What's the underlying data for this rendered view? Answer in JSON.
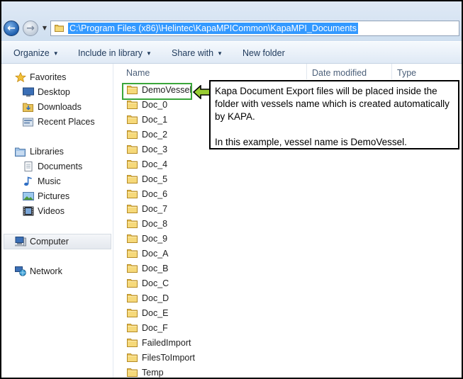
{
  "address_bar": {
    "path": "C:\\Program Files (x86)\\Helintec\\KapaMPICommon\\KapaMPI_Documents"
  },
  "toolbar": {
    "organize": "Organize",
    "include_in_library": "Include in library",
    "share_with": "Share with",
    "new_folder": "New folder"
  },
  "nav_pane": {
    "favorites": {
      "label": "Favorites",
      "items": [
        "Desktop",
        "Downloads",
        "Recent Places"
      ]
    },
    "libraries": {
      "label": "Libraries",
      "items": [
        "Documents",
        "Music",
        "Pictures",
        "Videos"
      ]
    },
    "computer": "Computer",
    "network": "Network"
  },
  "columns": {
    "name": "Name",
    "date_modified": "Date modified",
    "type": "Type"
  },
  "files": [
    "DemoVessel",
    "Doc_0",
    "Doc_1",
    "Doc_2",
    "Doc_3",
    "Doc_4",
    "Doc_5",
    "Doc_6",
    "Doc_7",
    "Doc_8",
    "Doc_9",
    "Doc_A",
    "Doc_B",
    "Doc_C",
    "Doc_D",
    "Doc_E",
    "Doc_F",
    "FailedImport",
    "FilesToImport",
    "Temp"
  ],
  "annotation": {
    "paragraph1": "Kapa Document Export files will be placed inside the folder with vessels name which is created automatically by KAPA.",
    "paragraph2": "In this example, vessel name is DemoVessel."
  },
  "colors": {
    "highlight_border": "#3aa63a",
    "arrow_fill": "#99cc33",
    "selection": "#3399ff"
  }
}
